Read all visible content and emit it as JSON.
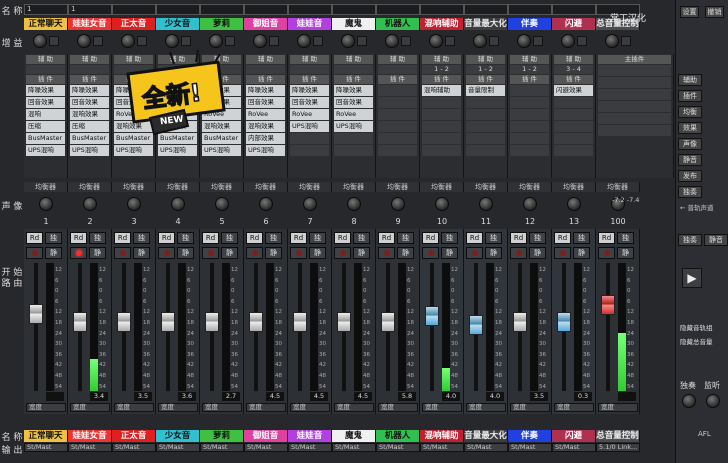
{
  "labels": {
    "name": "名 称",
    "gain": "增 益",
    "pan": "声 像",
    "start": "开 始",
    "routing": "路 由",
    "name_bottom": "名 称",
    "output": "输 出"
  },
  "top_inputs": [
    "1",
    "1",
    "",
    "",
    "",
    "",
    "",
    "",
    "",
    "",
    "",
    "",
    "",
    "",
    ""
  ],
  "channels": [
    {
      "name": "正常聊天",
      "color": "#f0c040",
      "fg": "#111",
      "num": "1",
      "value": "",
      "meter": 0,
      "fader": 0.62,
      "rec_on": false
    },
    {
      "name": "娃娃女音",
      "color": "#e33",
      "fg": "#fff",
      "num": "2",
      "value": "3.4",
      "meter": 0.25,
      "fader": 0.55,
      "rec_on": true
    },
    {
      "name": "正太音",
      "color": "#e02020",
      "fg": "#fff",
      "num": "3",
      "value": "3.5",
      "meter": 0,
      "fader": 0.55,
      "rec_on": false
    },
    {
      "name": "少女音",
      "color": "#30c0d0",
      "fg": "#111",
      "num": "4",
      "value": "3.6",
      "meter": 0,
      "fader": 0.55,
      "rec_on": false
    },
    {
      "name": "萝莉",
      "color": "#40c040",
      "fg": "#111",
      "num": "5",
      "value": "2.7",
      "meter": 0,
      "fader": 0.55,
      "rec_on": false
    },
    {
      "name": "御姐音",
      "color": "#e040a0",
      "fg": "#fff",
      "num": "6",
      "value": "4.5",
      "meter": 0,
      "fader": 0.55,
      "rec_on": false
    },
    {
      "name": "娃娃音",
      "color": "#b040e0",
      "fg": "#fff",
      "num": "7",
      "value": "4.5",
      "meter": 0,
      "fader": 0.55,
      "rec_on": false
    },
    {
      "name": "魔鬼",
      "color": "#f0f0f0",
      "fg": "#111",
      "num": "8",
      "value": "4.5",
      "meter": 0,
      "fader": 0.55,
      "rec_on": false
    },
    {
      "name": "机器人",
      "color": "#30c050",
      "fg": "#111",
      "num": "9",
      "value": "5.8",
      "meter": 0,
      "fader": 0.55,
      "rec_on": false
    },
    {
      "name": "混响辅助",
      "color": "#c02030",
      "fg": "#fff",
      "num": "10",
      "value": "4.0",
      "meter": 0.18,
      "fader": 0.6,
      "rec_on": false,
      "blue": true
    },
    {
      "name": "音量最大化",
      "color": "#3b3d41",
      "fg": "#eee",
      "num": "11",
      "value": "4.0",
      "meter": 0,
      "fader": 0.52,
      "rec_on": false,
      "blue": true
    },
    {
      "name": "伴奏",
      "color": "#2040e0",
      "fg": "#fff",
      "num": "12",
      "value": "3.5",
      "meter": 0,
      "fader": 0.55,
      "rec_on": false
    },
    {
      "name": "闪避",
      "color": "#b03050",
      "fg": "#fff",
      "num": "13",
      "value": "0.3",
      "meter": 0,
      "fader": 0.55,
      "rec_on": false,
      "blue": true
    },
    {
      "name": "总音量控制",
      "color": "#4a4c50",
      "fg": "#eee",
      "num": "100",
      "value": "",
      "meter": 0.45,
      "fader": 0.7,
      "rec_on": false,
      "master": true
    }
  ],
  "insert_slots": [
    [
      "降噪效果",
      "回音效果",
      "混响",
      "压缩",
      "BusMaster",
      "UPS混响"
    ],
    [
      "降噪效果",
      "回音效果",
      "混响效果",
      "压缩",
      "BusMaster",
      "UPS混响"
    ],
    [
      "降噪效果",
      "回音效果",
      "RoVee",
      "混响效果",
      "BusMaster",
      "UPS混响"
    ],
    [
      "降噪效果",
      "回音效果",
      "RoVee",
      "混响效果",
      "BusMaster",
      "UPS混响"
    ],
    [
      "降噪效果",
      "回音效果",
      "RoVee",
      "混响效果",
      "BusMaster",
      "UPS混响"
    ],
    [
      "降噪效果",
      "回音效果",
      "RoVee",
      "混响效果",
      "内部效果",
      "UPS混响"
    ],
    [
      "降噪效果",
      "回音效果",
      "RoVee",
      "UPS混响",
      "",
      ""
    ],
    [
      "降噪效果",
      "回音效果",
      "RoVee",
      "UPS混响",
      "",
      ""
    ],
    [
      "",
      "",
      "",
      "",
      "",
      ""
    ],
    [
      "混响辅助",
      "",
      "",
      "",
      "",
      ""
    ],
    [
      "音量限制",
      "",
      "",
      "",
      "",
      ""
    ],
    [
      "",
      "",
      "",
      "",
      "",
      ""
    ],
    [
      "闪避效果",
      "",
      "",
      "",
      "",
      ""
    ]
  ],
  "sends_header": "辅 助",
  "aux_returns": [
    "1 - 2",
    "1 - 2",
    "1 - 2",
    "3 - 4",
    "5 - 6",
    "7 - 8",
    "7 - 8"
  ],
  "inserts_label": "插 件",
  "main_inserts": "主插件",
  "eq_label": "均衡器",
  "fast_label": "快 照",
  "right": {
    "title": "常工汉化",
    "btn_settings": "设置",
    "btn_undo": "撤销",
    "btns": [
      "辅助",
      "插件",
      "均衡",
      "效果",
      "声像",
      "静音",
      "发布",
      "独奏"
    ],
    "link": "← 普轨声道",
    "solo": "独奏",
    "monitor": "监听",
    "hide_labels": "隐藏音轨组",
    "hide_master": "隐藏总音量",
    "afl": "AFL",
    "master_readout": "-7.2  -7.4"
  },
  "bottom": {
    "out_label": "St/Mast",
    "master_out": "5.1/0 Link...",
    "master_sel": "输出到音箱"
  },
  "badge": {
    "text": "全新!",
    "sub": "NEW"
  }
}
